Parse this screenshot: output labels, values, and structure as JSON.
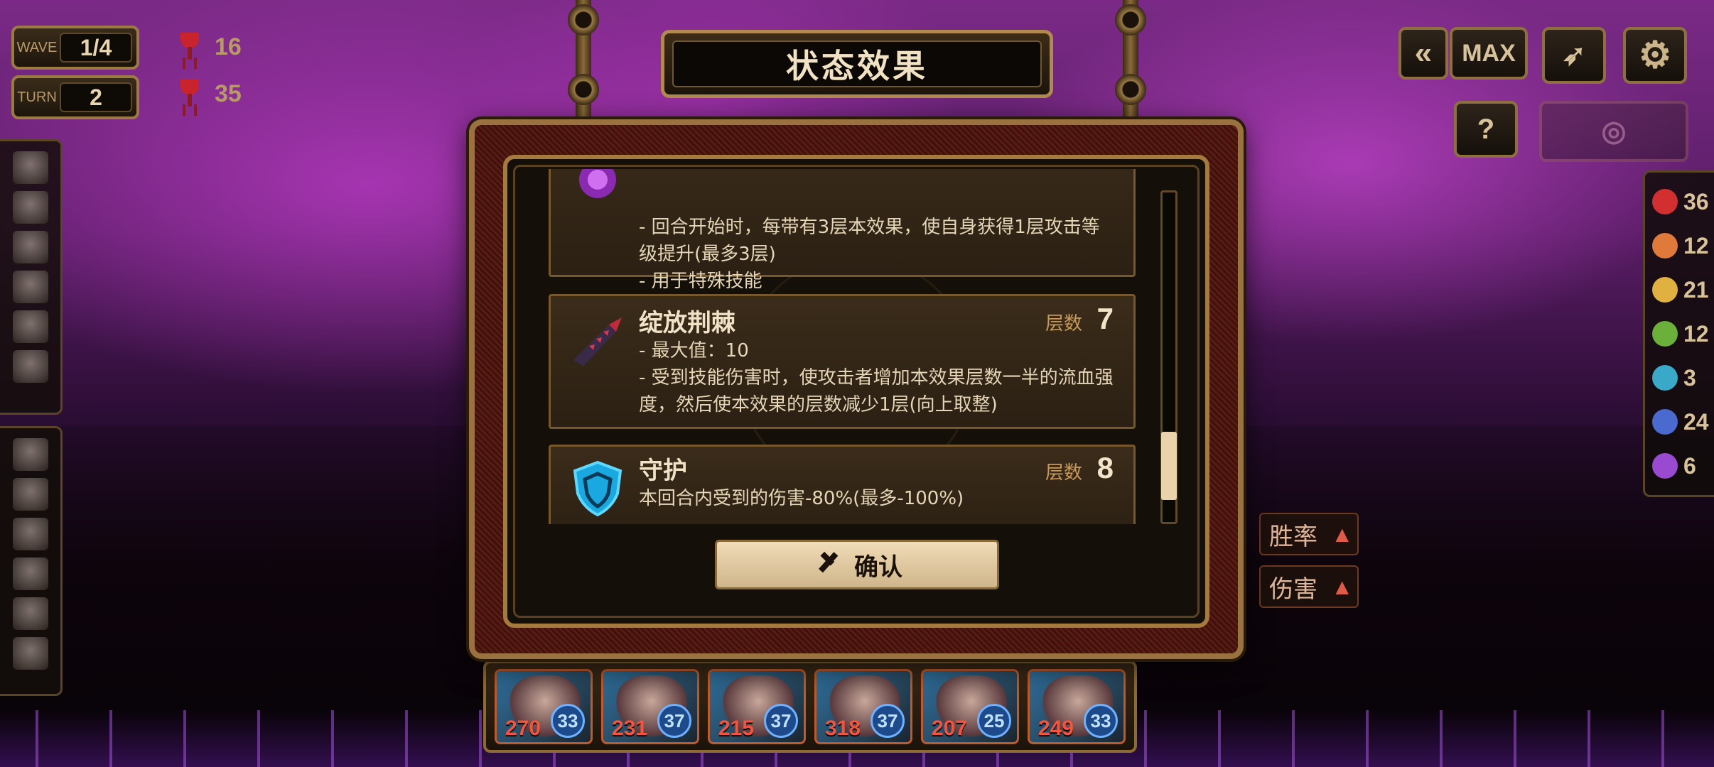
{
  "hud": {
    "wave_label": "WAVE",
    "wave_value": "1/4",
    "turn_label": "TURN",
    "turn_value": "2",
    "stat_top": "16",
    "stat_bottom": "35"
  },
  "top_right": {
    "speed_label": "MAX"
  },
  "elements": [
    {
      "value": "36",
      "color": "#d23030"
    },
    {
      "value": "12",
      "color": "#e07a3a"
    },
    {
      "value": "21",
      "color": "#e0b040"
    },
    {
      "value": "12",
      "color": "#6ab03a"
    },
    {
      "value": "3",
      "color": "#3aa8c8"
    },
    {
      "value": "24",
      "color": "#4a6ad0"
    },
    {
      "value": "6",
      "color": "#9a4ad0"
    }
  ],
  "side_tabs": {
    "win_rate": "胜率",
    "damage": "伤害"
  },
  "dialog": {
    "title": "状态效果",
    "effects": [
      {
        "name": "",
        "icon": "purple-burst-icon",
        "stack_label": "",
        "stack_value": "",
        "desc": [
          "- 回合开始时，每带有3层本效果，使自身获得1层攻击等级提升(最多3层)",
          "- 用于特殊技能"
        ]
      },
      {
        "name": "绽放荆棘",
        "icon": "thorn-blade-icon",
        "stack_label": "层数",
        "stack_value": "7",
        "desc": [
          "- 最大值：10",
          "- 受到技能伤害时，使攻击者增加本效果层数一半的流血强度，然后使本效果的层数减少1层(向上取整)"
        ]
      },
      {
        "name": "守护",
        "icon": "shield-icon",
        "stack_label": "层数",
        "stack_value": "8",
        "desc": [
          "本回合内受到的伤害-80%(最多-100%)"
        ]
      }
    ],
    "confirm_label": "确认"
  },
  "party": [
    {
      "hp": "270",
      "sp": "33"
    },
    {
      "hp": "231",
      "sp": "37"
    },
    {
      "hp": "215",
      "sp": "37"
    },
    {
      "hp": "318",
      "sp": "37"
    },
    {
      "hp": "207",
      "sp": "25"
    },
    {
      "hp": "249",
      "sp": "33"
    }
  ]
}
